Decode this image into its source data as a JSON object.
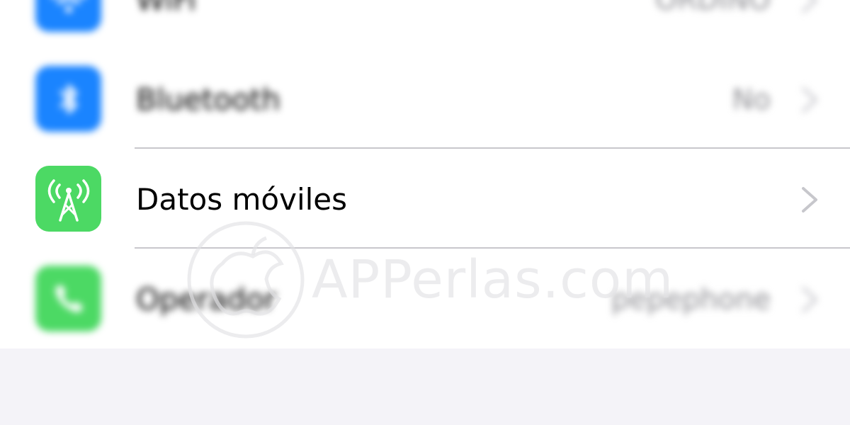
{
  "settings": {
    "rows": [
      {
        "label": "WiFi",
        "value": "ORDINO",
        "icon": "wifi-icon",
        "icon_color": "#1a84ff"
      },
      {
        "label": "Bluetooth",
        "value": "No",
        "icon": "bluetooth-icon",
        "icon_color": "#1a84ff"
      },
      {
        "label": "Datos móviles",
        "value": "",
        "icon": "cellular-antenna-icon",
        "icon_color": "#4cd964"
      },
      {
        "label": "Operador",
        "value": "pepephone",
        "icon": "phone-icon",
        "icon_color": "#4cd964"
      }
    ]
  },
  "watermark": {
    "text": "APPerlas.com"
  },
  "colors": {
    "separator": "#c8c7cc",
    "chevron": "#c7c7cc",
    "group_background": "#f4f3f8"
  }
}
